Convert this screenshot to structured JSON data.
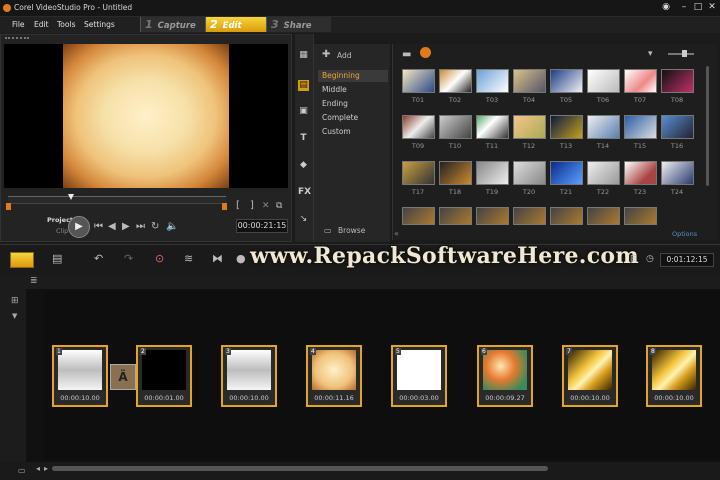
{
  "window": {
    "title": "Corel VideoStudio Pro - Untitled"
  },
  "menu": [
    "File",
    "Edit",
    "Tools",
    "Settings"
  ],
  "steps": [
    {
      "num": "1",
      "label": "Capture"
    },
    {
      "num": "2",
      "label": "Edit"
    },
    {
      "num": "3",
      "label": "Share"
    }
  ],
  "player": {
    "project_label": "Project",
    "clip_label": "Clip",
    "timecode": "00:00:21:15",
    "trim_in": "[",
    "trim_out": "]"
  },
  "library": {
    "add_label": "Add",
    "browse_label": "Browse",
    "categories": [
      "Beginning",
      "Middle",
      "Ending",
      "Complete",
      "Custom"
    ],
    "selected_category": "Beginning",
    "options_label": "Options",
    "thumbnails": [
      "T01",
      "T02",
      "T03",
      "T04",
      "T05",
      "T06",
      "T07",
      "T08",
      "T09",
      "T10",
      "T11",
      "T12",
      "T13",
      "T14",
      "T15",
      "T16",
      "T17",
      "T18",
      "T19",
      "T20",
      "T21",
      "T22",
      "T23",
      "T24"
    ]
  },
  "watermark": "www.RepackSoftwareHere.com",
  "timeline": {
    "total_time": "0:01:12:15",
    "clips": [
      {
        "num": "1",
        "duration": "00:00:10.00"
      },
      {
        "num": "2",
        "duration": "00:00:01.00"
      },
      {
        "num": "3",
        "duration": "00:00:10.00"
      },
      {
        "num": "4",
        "duration": "00:00:11.16"
      },
      {
        "num": "5",
        "duration": "00:00:03.00"
      },
      {
        "num": "6",
        "duration": "00:00:09.27"
      },
      {
        "num": "7",
        "duration": "00:00:10.00"
      },
      {
        "num": "8",
        "duration": "00:00:10.00"
      }
    ]
  },
  "colors": {
    "accent": "#e3a526",
    "active_step": "#f7d53a",
    "selected_category": "#f0a43a"
  }
}
